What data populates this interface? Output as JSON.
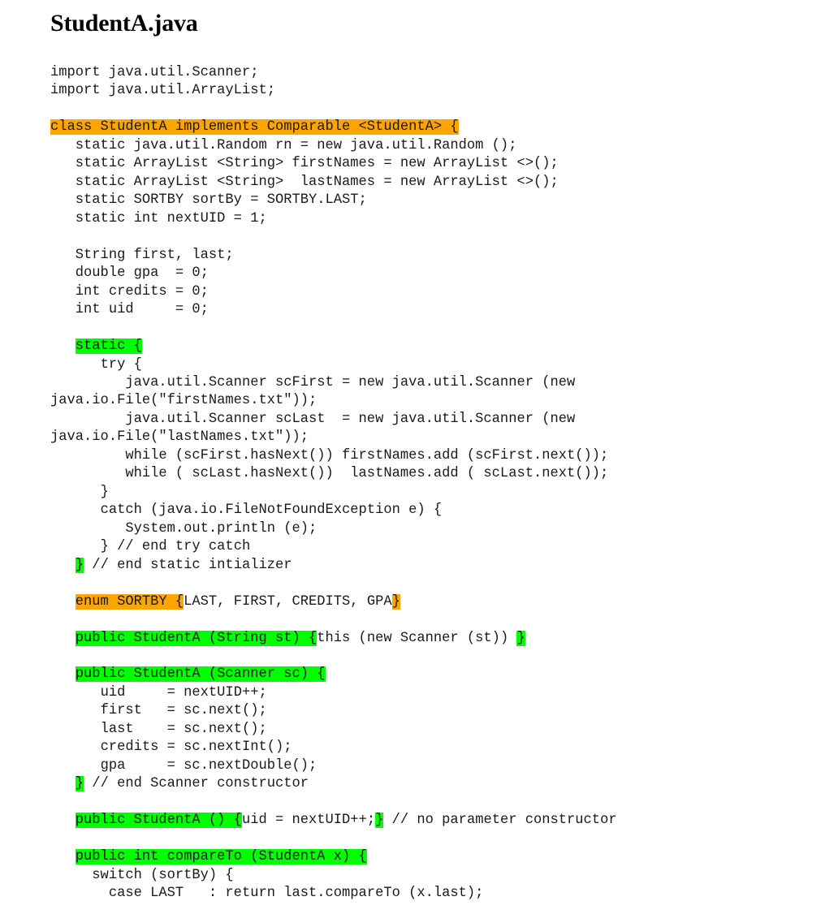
{
  "document": {
    "title": "StudentA.java",
    "language": "java",
    "colors": {
      "highlight_green": "#00FF00",
      "highlight_orange": "#FFA500",
      "text": "#1A1A1A",
      "background": "#FFFFFF"
    }
  },
  "code": {
    "lines": [
      {
        "segments": [
          {
            "text": "import java.util.Scanner;",
            "style": "plain"
          }
        ]
      },
      {
        "segments": [
          {
            "text": "import java.util.ArrayList;",
            "style": "plain"
          }
        ]
      },
      {
        "segments": [
          {
            "text": "",
            "style": "plain"
          }
        ]
      },
      {
        "segments": [
          {
            "text": "class StudentA implements Comparable <StudentA> {",
            "style": "orange"
          }
        ]
      },
      {
        "segments": [
          {
            "text": "   static java.util.Random rn = new java.util.Random ();",
            "style": "plain"
          }
        ]
      },
      {
        "segments": [
          {
            "text": "   static ArrayList <String> firstNames = new ArrayList <>();",
            "style": "plain"
          }
        ]
      },
      {
        "segments": [
          {
            "text": "   static ArrayList <String>  lastNames = new ArrayList <>();",
            "style": "plain"
          }
        ]
      },
      {
        "segments": [
          {
            "text": "   static SORTBY sortBy = SORTBY.LAST;",
            "style": "plain"
          }
        ]
      },
      {
        "segments": [
          {
            "text": "   static int nextUID = 1;",
            "style": "plain"
          }
        ]
      },
      {
        "segments": [
          {
            "text": "",
            "style": "plain"
          }
        ]
      },
      {
        "segments": [
          {
            "text": "   String first, last;",
            "style": "plain"
          }
        ]
      },
      {
        "segments": [
          {
            "text": "   double gpa  = 0;",
            "style": "plain"
          }
        ]
      },
      {
        "segments": [
          {
            "text": "   int credits = 0;",
            "style": "plain"
          }
        ]
      },
      {
        "segments": [
          {
            "text": "   int uid     = 0;",
            "style": "plain"
          }
        ]
      },
      {
        "segments": [
          {
            "text": "",
            "style": "plain"
          }
        ]
      },
      {
        "segments": [
          {
            "text": "   ",
            "style": "plain"
          },
          {
            "text": "static {",
            "style": "green"
          }
        ]
      },
      {
        "segments": [
          {
            "text": "      try {",
            "style": "plain"
          }
        ]
      },
      {
        "segments": [
          {
            "text": "         java.util.Scanner scFirst = new java.util.Scanner (new java.io.File(\"firstNames.txt\"));",
            "style": "plain"
          }
        ]
      },
      {
        "segments": [
          {
            "text": "         java.util.Scanner scLast  = new java.util.Scanner (new java.io.File(\"lastNames.txt\"));",
            "style": "plain"
          }
        ]
      },
      {
        "segments": [
          {
            "text": "         while (scFirst.hasNext()) firstNames.add (scFirst.next());",
            "style": "plain"
          }
        ]
      },
      {
        "segments": [
          {
            "text": "         while ( scLast.hasNext())  lastNames.add ( scLast.next());",
            "style": "plain"
          }
        ]
      },
      {
        "segments": [
          {
            "text": "      }",
            "style": "plain"
          }
        ]
      },
      {
        "segments": [
          {
            "text": "      catch (java.io.FileNotFoundException e) {",
            "style": "plain"
          }
        ]
      },
      {
        "segments": [
          {
            "text": "         System.out.println (e);",
            "style": "plain"
          }
        ]
      },
      {
        "segments": [
          {
            "text": "      } // end try catch",
            "style": "plain"
          }
        ]
      },
      {
        "segments": [
          {
            "text": "   ",
            "style": "plain"
          },
          {
            "text": "}",
            "style": "green"
          },
          {
            "text": " // end static intializer",
            "style": "plain"
          }
        ]
      },
      {
        "segments": [
          {
            "text": "",
            "style": "plain"
          }
        ]
      },
      {
        "segments": [
          {
            "text": "   ",
            "style": "plain"
          },
          {
            "text": "enum SORTBY {",
            "style": "orange"
          },
          {
            "text": "LAST, FIRST, CREDITS, GPA",
            "style": "plain"
          },
          {
            "text": "}",
            "style": "orange"
          }
        ]
      },
      {
        "segments": [
          {
            "text": "",
            "style": "plain"
          }
        ]
      },
      {
        "segments": [
          {
            "text": "   ",
            "style": "plain"
          },
          {
            "text": "public StudentA (String st) {",
            "style": "green"
          },
          {
            "text": "this (new Scanner (st)) ",
            "style": "plain"
          },
          {
            "text": "}",
            "style": "green"
          }
        ]
      },
      {
        "segments": [
          {
            "text": "",
            "style": "plain"
          }
        ]
      },
      {
        "segments": [
          {
            "text": "   ",
            "style": "plain"
          },
          {
            "text": "public StudentA (Scanner sc) {",
            "style": "green"
          }
        ]
      },
      {
        "segments": [
          {
            "text": "      uid     = nextUID++;",
            "style": "plain"
          }
        ]
      },
      {
        "segments": [
          {
            "text": "      first   = sc.next();",
            "style": "plain"
          }
        ]
      },
      {
        "segments": [
          {
            "text": "      last    = sc.next();",
            "style": "plain"
          }
        ]
      },
      {
        "segments": [
          {
            "text": "      credits = sc.nextInt();",
            "style": "plain"
          }
        ]
      },
      {
        "segments": [
          {
            "text": "      gpa     = sc.nextDouble();",
            "style": "plain"
          }
        ]
      },
      {
        "segments": [
          {
            "text": "   ",
            "style": "plain"
          },
          {
            "text": "}",
            "style": "green"
          },
          {
            "text": " // end Scanner constructor",
            "style": "plain"
          }
        ]
      },
      {
        "segments": [
          {
            "text": "",
            "style": "plain"
          }
        ]
      },
      {
        "segments": [
          {
            "text": "   ",
            "style": "plain"
          },
          {
            "text": "public StudentA () {",
            "style": "green"
          },
          {
            "text": "uid = nextUID++;",
            "style": "plain"
          },
          {
            "text": "}",
            "style": "green"
          },
          {
            "text": " // no parameter constructor",
            "style": "plain"
          }
        ]
      },
      {
        "segments": [
          {
            "text": "",
            "style": "plain"
          }
        ]
      },
      {
        "segments": [
          {
            "text": "   ",
            "style": "plain"
          },
          {
            "text": "public int compareTo (StudentA x) {",
            "style": "green"
          }
        ]
      },
      {
        "segments": [
          {
            "text": "     switch (sortBy) {",
            "style": "plain"
          }
        ]
      },
      {
        "segments": [
          {
            "text": "       case LAST   : return last.compareTo (x.last);",
            "style": "plain"
          }
        ]
      }
    ]
  }
}
